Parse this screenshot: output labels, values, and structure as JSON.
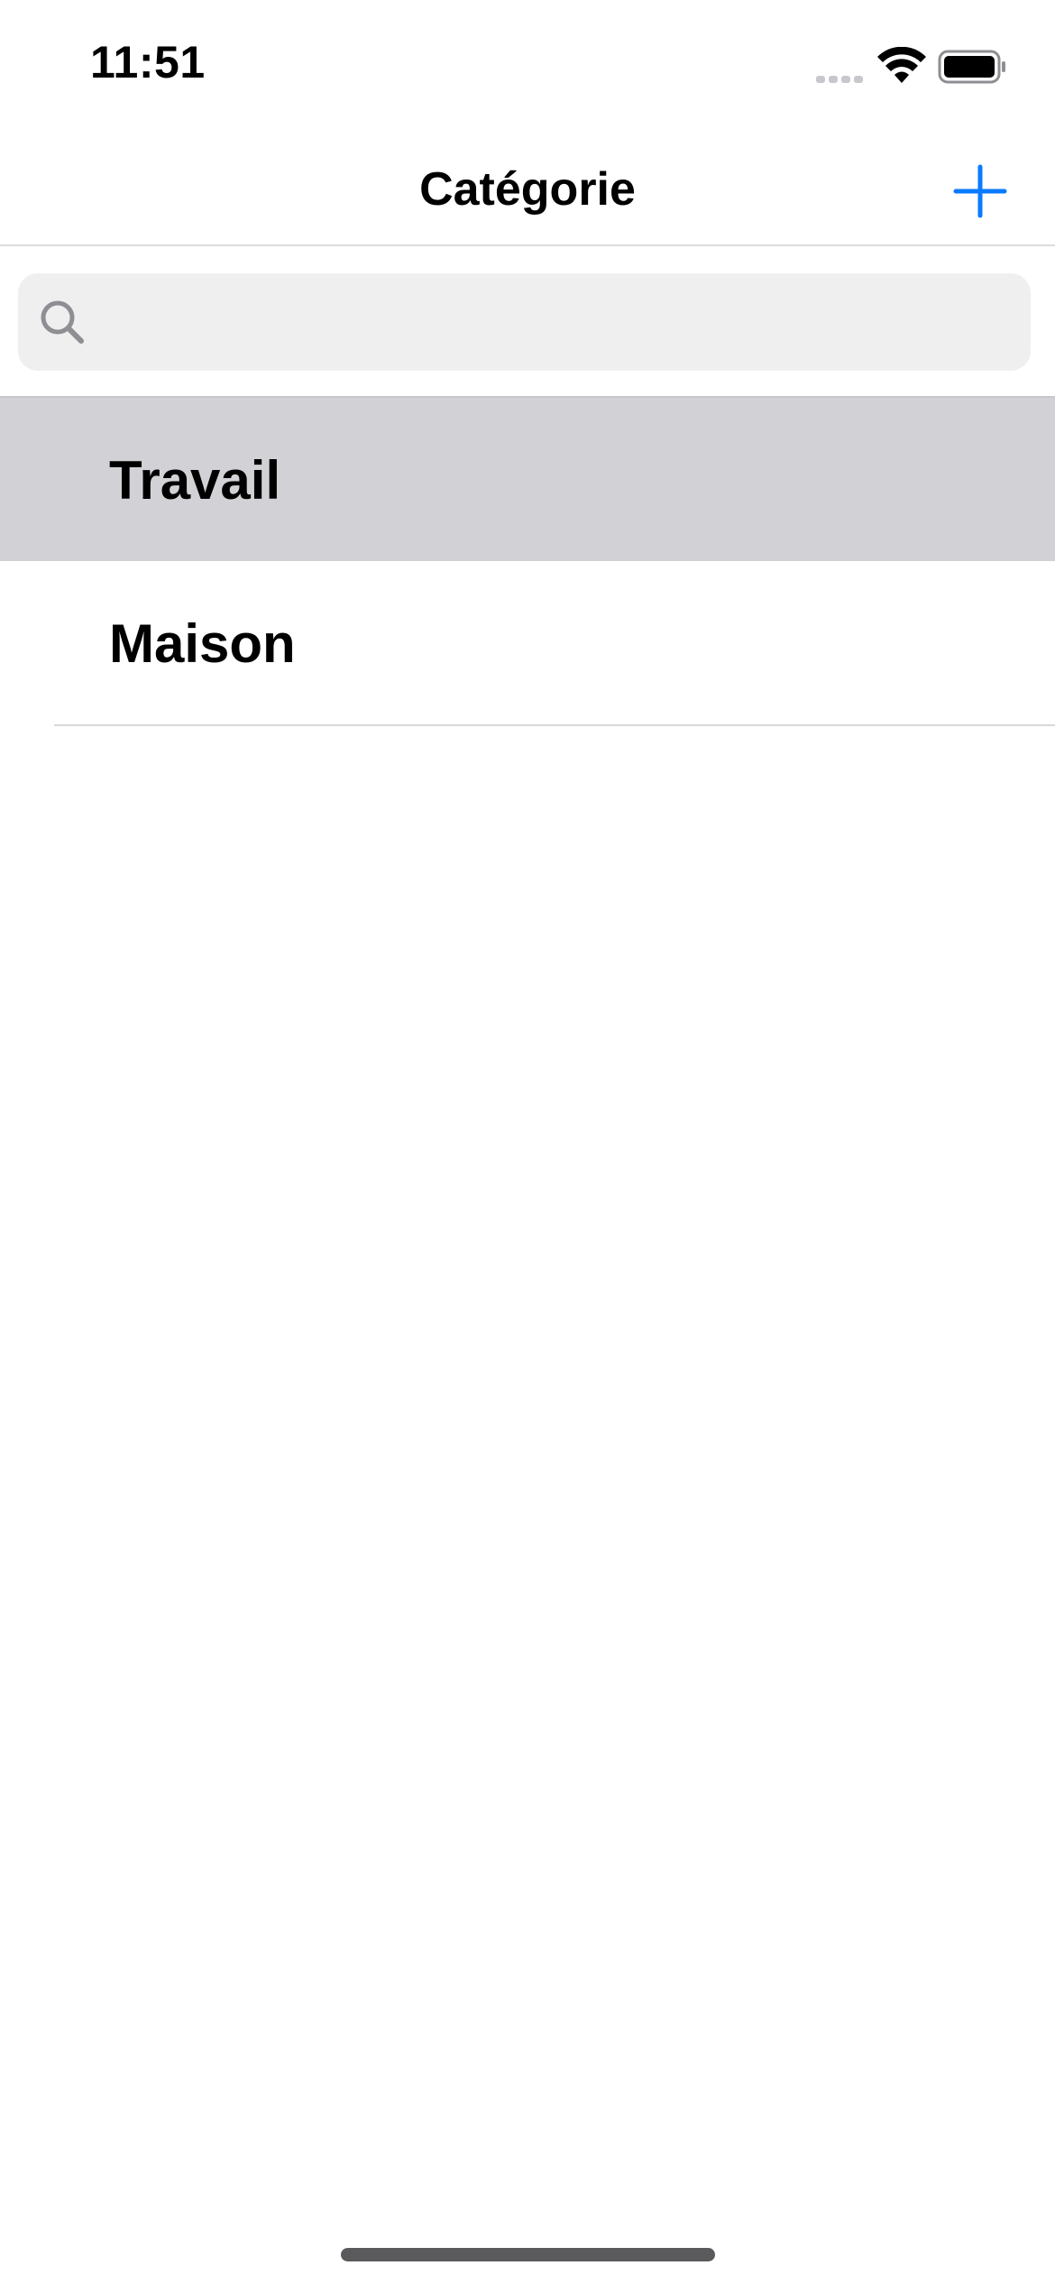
{
  "status_bar": {
    "time": "11:51"
  },
  "nav": {
    "title": "Catégorie",
    "add_icon": "plus-icon"
  },
  "search": {
    "placeholder": "",
    "value": "",
    "icon": "search-icon"
  },
  "categories": [
    {
      "label": "Travail",
      "selected": true
    },
    {
      "label": "Maison",
      "selected": false
    }
  ],
  "colors": {
    "accent": "#0a7aff",
    "selected_row": "#d2d2d6",
    "search_bg": "#efeff0"
  }
}
